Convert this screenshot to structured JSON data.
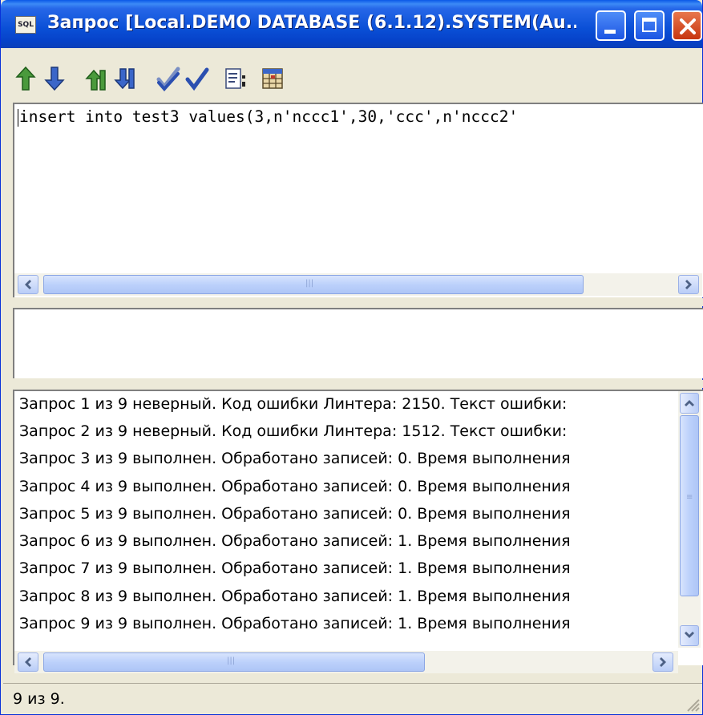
{
  "window": {
    "title": "Запрос [Local.DEMO DATABASE (6.1.12).SYSTEM(Au...",
    "icon_label": "SQL"
  },
  "toolbar": {
    "buttons": [
      {
        "icon": "arrow-up-green-icon"
      },
      {
        "icon": "arrow-down-blue-icon"
      },
      {
        "icon": "arrow-up-first-icon"
      },
      {
        "icon": "arrow-down-last-icon"
      },
      {
        "icon": "check-all-icon"
      },
      {
        "icon": "checkmark-icon"
      },
      {
        "icon": "document-run-icon"
      },
      {
        "icon": "results-grid-icon"
      }
    ]
  },
  "editor": {
    "text": "insert into test3 values(3,n'nccc1',30,'ccc',n'nccc2'"
  },
  "log": {
    "rows": [
      "Запрос 1 из 9 неверный. Код ошибки Линтера: 2150. Текст ошибки:",
      "Запрос 2 из 9 неверный. Код ошибки Линтера: 1512. Текст ошибки:",
      "Запрос 3 из 9 выполнен. Обработано записей: 0. Время выполнения",
      "Запрос 4 из 9 выполнен. Обработано записей: 0. Время выполнения",
      "Запрос 5 из 9 выполнен. Обработано записей: 0. Время выполнения",
      "Запрос 6 из 9 выполнен. Обработано записей: 1. Время выполнения",
      "Запрос 7 из 9 выполнен. Обработано записей: 1. Время выполнения",
      "Запрос 8 из 9 выполнен. Обработано записей: 1. Время выполнения",
      "Запрос 9 из 9 выполнен. Обработано записей: 1. Время выполнения"
    ]
  },
  "status": {
    "text": "9 из 9."
  },
  "colors": {
    "titlebar": "#0a4fd6",
    "close_button": "#c7350f",
    "window_bg": "#ece9d8"
  }
}
